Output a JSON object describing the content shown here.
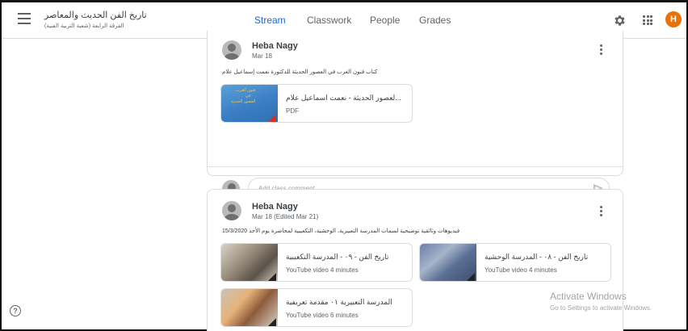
{
  "header": {
    "class_title": "تاريخ الفن الحديث والمعاصر",
    "class_subtitle": "الفرقة الرابعة (شعبة التربية الفنية)",
    "tabs": [
      {
        "label": "Stream",
        "active": true
      },
      {
        "label": "Classwork",
        "active": false
      },
      {
        "label": "People",
        "active": false
      },
      {
        "label": "Grades",
        "active": false
      }
    ],
    "user_initial": "H",
    "user_color": "#e8710a",
    "accent_color": "#1967d2"
  },
  "posts": [
    {
      "author": "Heba Nagy",
      "date": "Mar 18",
      "text": "كتاب فنون الغرب في العصور الحديثة للدكتورة نعمت إسماعيل علام",
      "attachments": [
        {
          "title": "...لعصور الحديثة - نعمت اسماعيل علام",
          "meta": "PDF",
          "thumb_lines": [
            "فنون الغرب",
            "في",
            "العصور الحديثة"
          ],
          "icon": "pdf-icon"
        }
      ],
      "comment_placeholder": "Add class comment..."
    },
    {
      "author": "Heba Nagy",
      "date": "Mar 18 (Edited Mar 21)",
      "text": "فيديوهات وثائقية توضيحية لسمات المدرسة التعبيرية، الوحشية، التكعيبية لمحاضرة يوم الأحد 15/3/2020",
      "attachments": [
        {
          "title": "تاريخ الفن - ٠٩ - المدرسة التكعيبية",
          "meta": "YouTube video   4 minutes",
          "icon": "video-icon"
        },
        {
          "title": "تاريخ الفن - ٠٨ - المدرسة الوحشية",
          "meta": "YouTube video   4 minutes",
          "icon": "video-icon"
        },
        {
          "title": "المدرسة التعبيرية ٠١ مقدمة تعريفية",
          "meta": "YouTube video   6 minutes",
          "icon": "video-icon"
        }
      ]
    }
  ],
  "watermark": {
    "line1": "Activate Windows",
    "line2": "Go to Settings to activate Windows."
  },
  "help_label": "?"
}
